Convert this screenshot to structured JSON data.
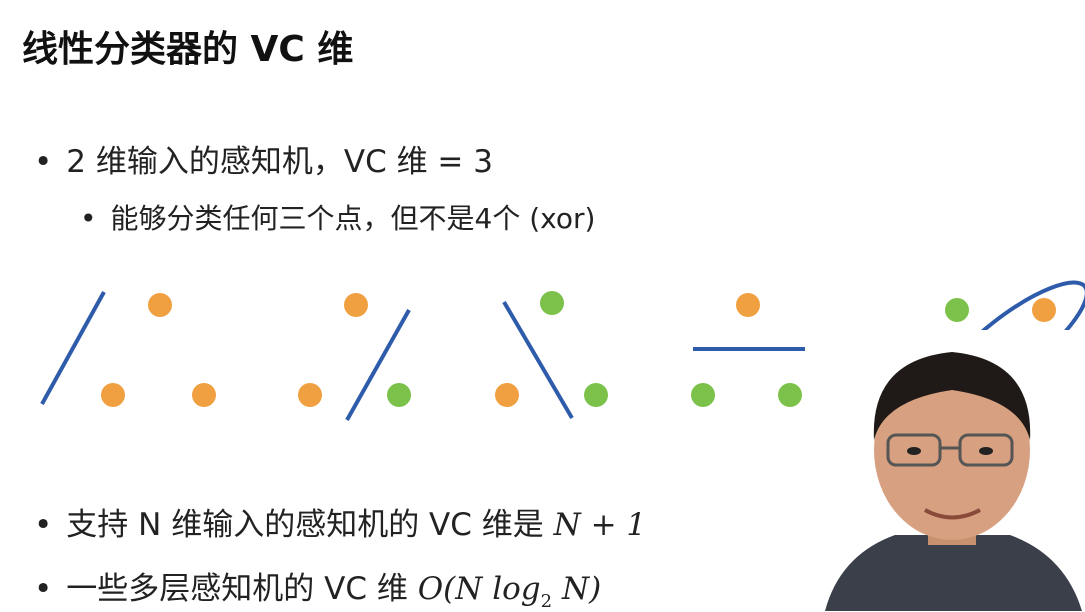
{
  "slide": {
    "title": "线性分类器的 VC 维",
    "bullets": {
      "b1": "2 维输入的感知机，VC 维 = 3",
      "b2": "能够分类任何三个点，但不是4个 (xor)",
      "b3_text": "支持 N 维输入的感知机的 VC 维是 ",
      "b3_math": "N + 1",
      "b4_text": "一些多层感知机的 VC 维 ",
      "b4_math_a": "O(N log",
      "b4_sub": "2",
      "b4_math_b": " N)"
    },
    "bullet_char": "•"
  },
  "colors": {
    "orange": "#F0A040",
    "green": "#7CC24A",
    "line": "#2E5CAA"
  },
  "diagrams": [
    {
      "points": [
        "orange",
        "orange",
        "orange"
      ]
    },
    {
      "points": [
        "orange",
        "orange",
        "green"
      ]
    },
    {
      "points": [
        "green",
        "orange",
        "green"
      ]
    },
    {
      "points": [
        "orange",
        "green",
        "green"
      ]
    },
    {
      "points": [
        "green",
        "orange",
        "green"
      ]
    }
  ],
  "presenter": {
    "icon": "presenter-video"
  }
}
